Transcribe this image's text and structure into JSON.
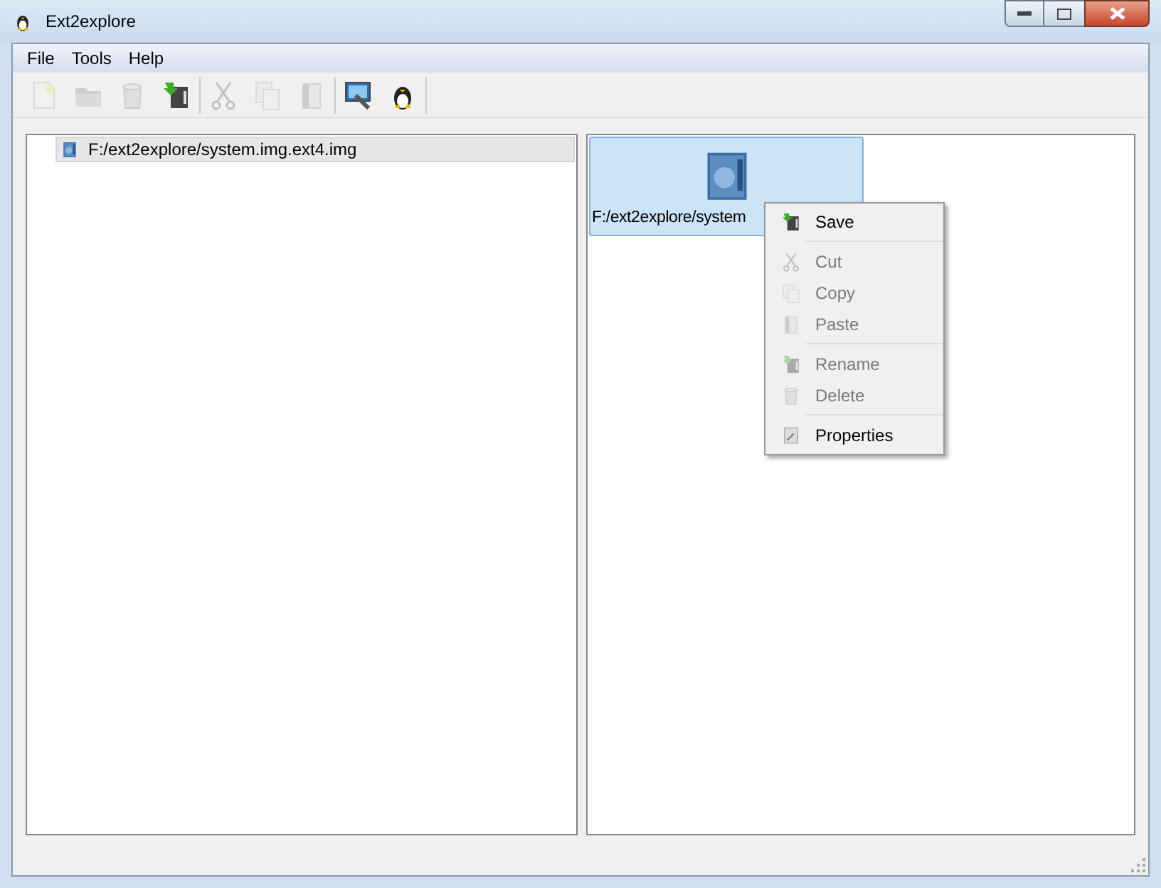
{
  "window": {
    "title": "Ext2explore"
  },
  "menu": [
    "File",
    "Tools",
    "Help"
  ],
  "toolbar": [
    [
      {
        "kind": "new",
        "disabled": true
      },
      {
        "kind": "open",
        "disabled": true
      },
      {
        "kind": "delete",
        "disabled": true
      },
      {
        "kind": "save",
        "disabled": false
      }
    ],
    [
      {
        "kind": "cut",
        "disabled": true
      },
      {
        "kind": "copy",
        "disabled": true
      },
      {
        "kind": "paste",
        "disabled": true
      }
    ],
    [
      {
        "kind": "tools",
        "disabled": false
      },
      {
        "kind": "linux",
        "disabled": false
      }
    ]
  ],
  "tree": [
    {
      "label": "F:/ext2explore/system.img.ext4.img",
      "selected": true
    }
  ],
  "files": [
    {
      "label": "F:/ext2explore/system",
      "selected": true
    }
  ],
  "context_menu": [
    [
      {
        "label": "Save",
        "kind": "save",
        "disabled": false
      }
    ],
    [
      {
        "label": "Cut",
        "kind": "cut",
        "disabled": true
      },
      {
        "label": "Copy",
        "kind": "copy",
        "disabled": true
      },
      {
        "label": "Paste",
        "kind": "paste",
        "disabled": true
      }
    ],
    [
      {
        "label": "Rename",
        "kind": "save",
        "disabled": true
      },
      {
        "label": "Delete",
        "kind": "delete",
        "disabled": true
      }
    ],
    [
      {
        "label": "Properties",
        "kind": "props",
        "disabled": false
      }
    ]
  ]
}
